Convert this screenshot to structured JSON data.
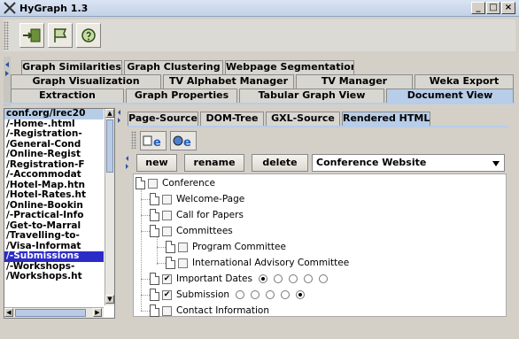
{
  "window": {
    "title": "HyGraph 1.3",
    "minimize": "_",
    "maximize": "□",
    "close": "×"
  },
  "toolbar": {
    "buttons": [
      "graph-import-icon",
      "flag-icon",
      "help-circle-icon"
    ]
  },
  "main_tabs": {
    "row1": [
      "Graph Similarities",
      "Graph Clustering",
      "Webpage Segmentation"
    ],
    "row2": [
      "Graph Visualization",
      "TV Alphabet Manager",
      "TV Manager",
      "Weka Export"
    ],
    "row3": [
      "Extraction",
      "Graph Properties",
      "Tabular Graph View",
      "Document View"
    ],
    "selected": "Document View"
  },
  "url_list": [
    "conf.org/lrec20",
    "/-Home-.html",
    "/-Registration-",
    "/General-Cond",
    "/Online-Regist",
    "/Registration-F",
    "/-Accommodat",
    "/Hotel-Map.htn",
    "/Hotel-Rates.ht",
    "/Online-Bookin",
    "/-Practical-Info",
    "/Get-to-Marral",
    "/Travelling-to-",
    "/Visa-Informat",
    "/-Submissions",
    "/-Workshops-",
    "/Workshops.ht"
  ],
  "url_selected_index": 14,
  "view_tabs": {
    "items": [
      "Page-Source",
      "DOM-Tree",
      "GXL-Source",
      "Rendered HTML"
    ],
    "selected": "Rendered HTML"
  },
  "actions": {
    "new": "new",
    "rename": "rename",
    "delete": "delete"
  },
  "category_select": {
    "value": "Conference Website"
  },
  "tree": {
    "root": "Conference",
    "items": [
      {
        "label": "Welcome-Page",
        "checked": false
      },
      {
        "label": "Call for Papers",
        "checked": false
      },
      {
        "label": "Committees",
        "checked": false
      },
      {
        "label": "Program Committee",
        "checked": false
      },
      {
        "label": "International Advisory Committee",
        "checked": false
      },
      {
        "label": "Important Dates",
        "checked": true,
        "radios": 5,
        "radio_selected": 0
      },
      {
        "label": "Submission",
        "checked": true,
        "radios": 5,
        "radio_selected": 4
      },
      {
        "label": "Contact Information",
        "checked": false
      }
    ]
  }
}
